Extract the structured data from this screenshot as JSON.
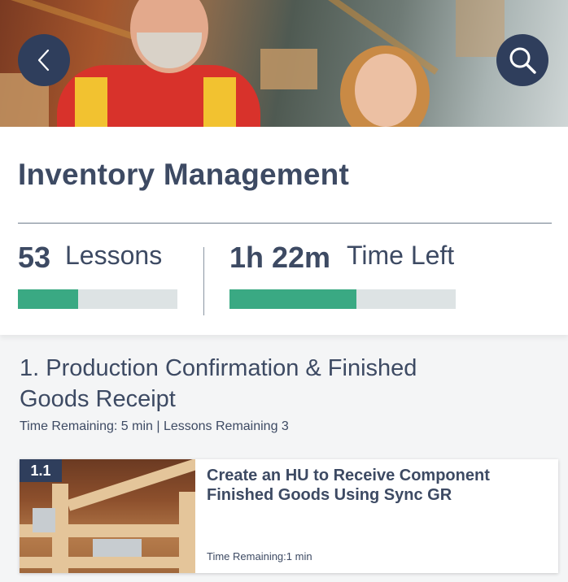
{
  "hero": {
    "back_icon": "chevron-left-icon",
    "search_icon": "search-icon",
    "button_color": "#2f3e5c"
  },
  "course": {
    "title": "Inventory Management",
    "lessons": {
      "count": "53",
      "label": "Lessons",
      "progress": 0.38
    },
    "time": {
      "value": "1h 22m",
      "label": "Time Left",
      "progress": 0.56
    },
    "accent_color": "#3aa983"
  },
  "section": {
    "title": "1. Production Confirmation & Finished Goods Receipt",
    "meta": "Time Remaining: 5 min | Lessons Remaining 3"
  },
  "lessons": [
    {
      "number": "1.1",
      "title": "Create an HU to Receive Component Finished Goods Using Sync GR",
      "time": "Time Remaining:1 min"
    }
  ]
}
